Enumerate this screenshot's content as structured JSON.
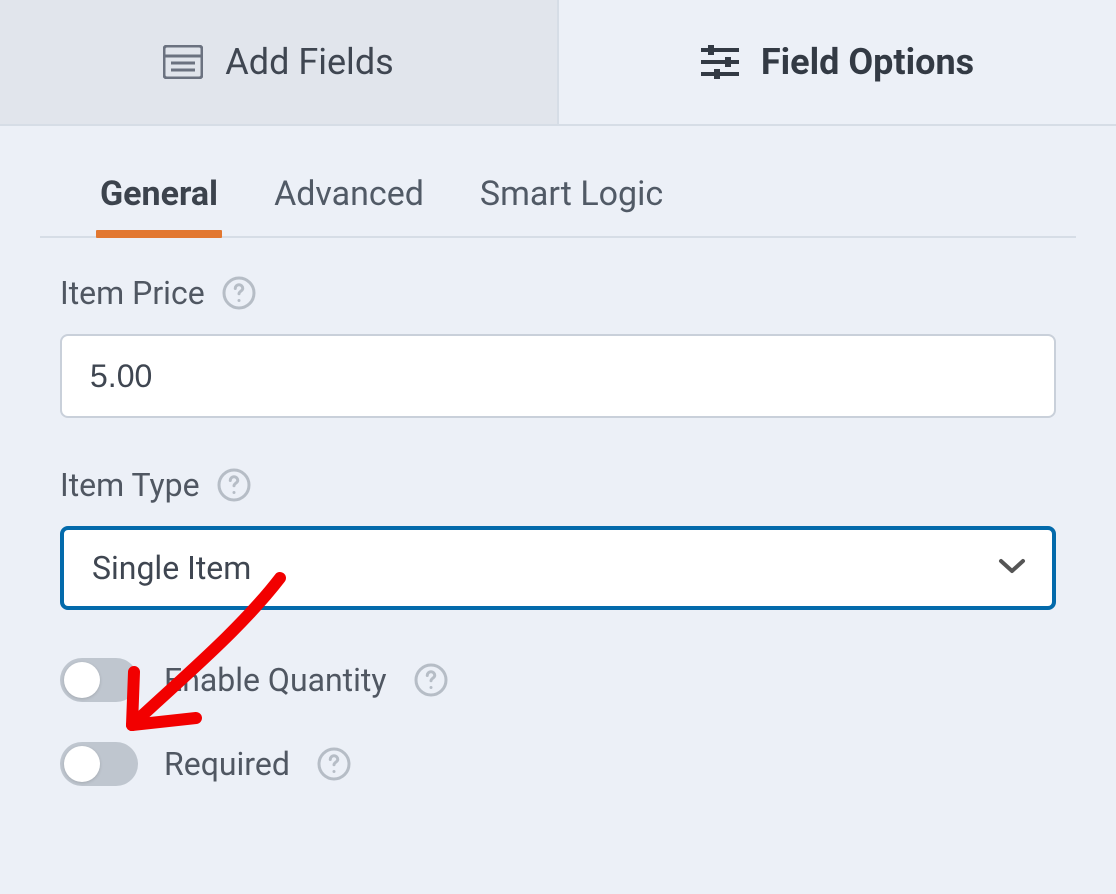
{
  "topTabs": {
    "addFields": "Add Fields",
    "fieldOptions": "Field Options"
  },
  "subTabs": {
    "general": "General",
    "advanced": "Advanced",
    "smartLogic": "Smart Logic"
  },
  "itemPrice": {
    "label": "Item Price",
    "value": "5.00"
  },
  "itemType": {
    "label": "Item Type",
    "value": "Single Item"
  },
  "enableQuantity": {
    "label": "Enable Quantity"
  },
  "required": {
    "label": "Required"
  }
}
